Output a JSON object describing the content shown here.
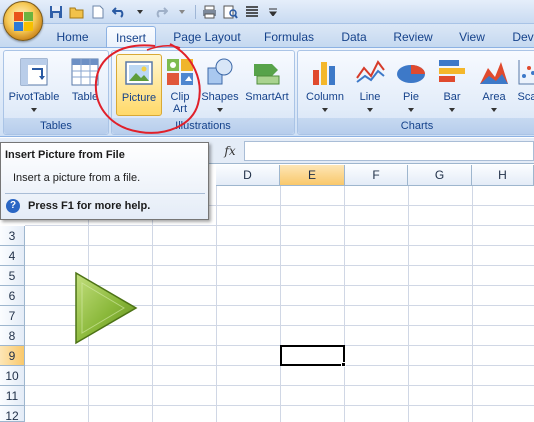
{
  "tabs": [
    {
      "label": "Home"
    },
    {
      "label": "Insert"
    },
    {
      "label": "Page Layout"
    },
    {
      "label": "Formulas"
    },
    {
      "label": "Data"
    },
    {
      "label": "Review"
    },
    {
      "label": "View"
    },
    {
      "label": "Dev"
    }
  ],
  "ribbon": {
    "tables": {
      "label": "Tables",
      "pivot_label": "PivotTable",
      "table_label": "Table"
    },
    "illustrations": {
      "label": "Illustrations",
      "picture_label": "Picture",
      "clipart_line1": "Clip",
      "clipart_line2": "Art",
      "shapes_label": "Shapes",
      "smartart_label": "SmartArt"
    },
    "charts": {
      "label": "Charts",
      "column_label": "Column",
      "line_label": "Line",
      "pie_label": "Pie",
      "bar_label": "Bar",
      "area_label": "Area",
      "scatter_label": "Sca"
    }
  },
  "formula_bar": {
    "fx": "fx"
  },
  "columns": [
    "D",
    "E",
    "F",
    "G",
    "H"
  ],
  "rows": [
    "3",
    "4",
    "5",
    "6",
    "7",
    "8",
    "9",
    "10",
    "11",
    "12"
  ],
  "selected_column": "E",
  "selected_row": "9",
  "tooltip": {
    "title": "Insert Picture from File",
    "body": "Insert a picture from a file.",
    "help": "Press F1 for more help."
  },
  "colors": {
    "annotation": "#e0202a",
    "shape_fill": "#8ab83a",
    "selection_header": "#f9c86b"
  }
}
